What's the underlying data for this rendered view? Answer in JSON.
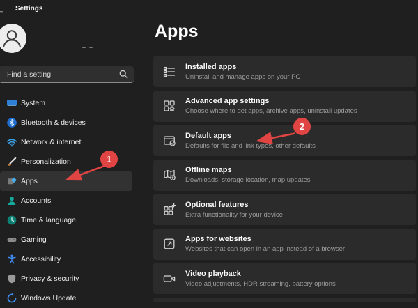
{
  "window": {
    "title": "Settings"
  },
  "sidebar": {
    "search": {
      "placeholder": "Find a setting"
    },
    "items": [
      {
        "label": "System",
        "icon": "system-icon",
        "selected": false
      },
      {
        "label": "Bluetooth & devices",
        "icon": "bluetooth-icon",
        "selected": false
      },
      {
        "label": "Network & internet",
        "icon": "network-icon",
        "selected": false
      },
      {
        "label": "Personalization",
        "icon": "personalization-icon",
        "selected": false
      },
      {
        "label": "Apps",
        "icon": "apps-icon",
        "selected": true
      },
      {
        "label": "Accounts",
        "icon": "accounts-icon",
        "selected": false
      },
      {
        "label": "Time & language",
        "icon": "time-language-icon",
        "selected": false
      },
      {
        "label": "Gaming",
        "icon": "gaming-icon",
        "selected": false
      },
      {
        "label": "Accessibility",
        "icon": "accessibility-icon",
        "selected": false
      },
      {
        "label": "Privacy & security",
        "icon": "privacy-security-icon",
        "selected": false
      },
      {
        "label": "Windows Update",
        "icon": "windows-update-icon",
        "selected": false
      }
    ]
  },
  "main": {
    "title": "Apps",
    "items": [
      {
        "title": "Installed apps",
        "subtitle": "Uninstall and manage apps on your PC",
        "icon": "installed-apps-icon"
      },
      {
        "title": "Advanced app settings",
        "subtitle": "Choose where to get apps, archive apps, uninstall updates",
        "icon": "advanced-app-settings-icon"
      },
      {
        "title": "Default apps",
        "subtitle": "Defaults for file and link types, other defaults",
        "icon": "default-apps-icon"
      },
      {
        "title": "Offline maps",
        "subtitle": "Downloads, storage location, map updates",
        "icon": "offline-maps-icon"
      },
      {
        "title": "Optional features",
        "subtitle": "Extra functionality for your device",
        "icon": "optional-features-icon"
      },
      {
        "title": "Apps for websites",
        "subtitle": "Websites that can open in an app instead of a browser",
        "icon": "apps-for-websites-icon"
      },
      {
        "title": "Video playback",
        "subtitle": "Video adjustments, HDR streaming, battery options",
        "icon": "video-playback-icon"
      }
    ]
  },
  "annotations": {
    "color": "#e04543",
    "step1": {
      "label": "1"
    },
    "step2": {
      "label": "2"
    }
  }
}
